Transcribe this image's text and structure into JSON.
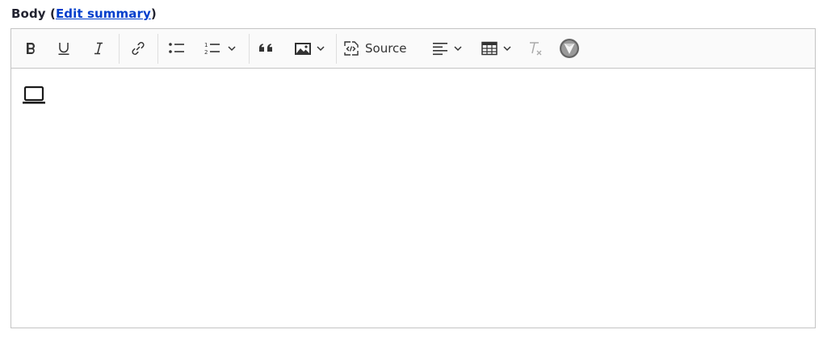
{
  "field": {
    "label": "Body",
    "open_paren": "(",
    "edit_summary_link": "Edit summary",
    "close_paren": ")"
  },
  "toolbar": {
    "buttons": [
      {
        "name": "bold",
        "icon": "bold-icon"
      },
      {
        "name": "underline",
        "icon": "underline-icon"
      },
      {
        "name": "italic",
        "icon": "italic-icon"
      },
      {
        "name": "link",
        "icon": "link-icon"
      },
      {
        "name": "bulleted-list",
        "icon": "bulleted-list-icon"
      },
      {
        "name": "numbered-list",
        "icon": "numbered-list-icon"
      },
      {
        "name": "block-quote",
        "icon": "quote-icon"
      },
      {
        "name": "insert-image",
        "icon": "image-icon"
      },
      {
        "name": "source",
        "icon": "source-icon"
      },
      {
        "name": "text-alignment",
        "icon": "align-left-icon"
      },
      {
        "name": "insert-table",
        "icon": "table-icon"
      },
      {
        "name": "remove-format",
        "icon": "remove-format-icon"
      },
      {
        "name": "media",
        "icon": "media-logo-icon"
      }
    ],
    "source_label": "Source"
  },
  "content": {
    "placeholder_icon": "laptop-icon"
  },
  "colors": {
    "link": "#003ecc",
    "border": "#c4c4c4",
    "icon": "#333333",
    "disabled_icon": "#aaaaaa"
  }
}
